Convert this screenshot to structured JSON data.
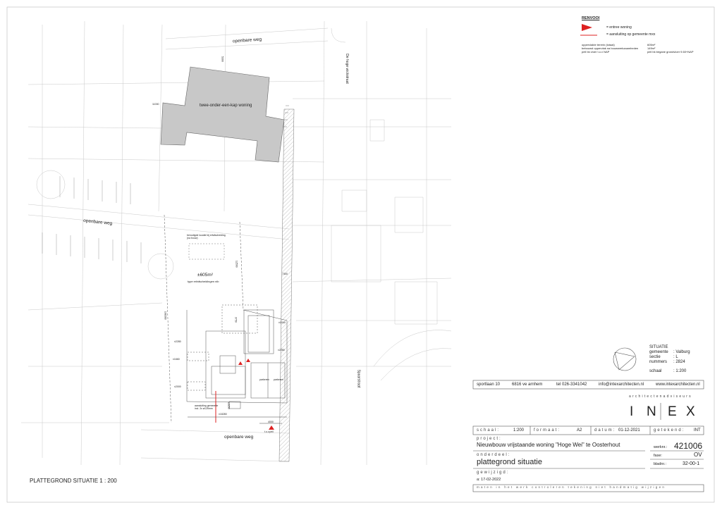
{
  "legend": {
    "title": "RENVOOI",
    "entrance": "= entree woning",
    "connection": "= aansluiting op gemeente mxx",
    "area_labels": [
      "oppervlakte terrein (totaal)",
      "bebouwd oppervlak na bouwwerkzaamheden",
      "peil bk vloer t.o.v NAP"
    ],
    "area_values": [
      "605m²",
      "149m²",
      "peil bk begane grondvloer 9.60+NAP"
    ]
  },
  "map": {
    "road_top": "openbare weg",
    "road_left": "openbare weg",
    "road_bottom": "openbare weg",
    "street_right_top": "De hoge wickstraat",
    "street_right_bottom": "Spaarstraat",
    "neighbor_house": "twee-onder-een-kap woning",
    "plot_area": "±605m²",
    "plot_note": "type erfafscheidingen nib",
    "box_note": "benodigde locatie bij erfafscheiding (na bouw)",
    "parking_labels": [
      "parkeren",
      "parkeren"
    ],
    "connection_note": "aansluiting gemeente incl. 2x ø125mm",
    "dims": [
      "5300",
      "11000",
      "12590",
      "7300",
      "±1000",
      "±2280",
      "±2280",
      "±1660",
      "±2000",
      "±18280",
      "±3250",
      "4000",
      "3750",
      "108300"
    ],
    "level_mark": "t.o.v.peil"
  },
  "drawing_title": "PLATTEGROND SITUATIE  1 : 200",
  "situatie": {
    "title": "SITUATIE",
    "rows": [
      {
        "k": "gemeente",
        "v": ": Valburg"
      },
      {
        "k": "sectie",
        "v": ": L"
      },
      {
        "k": "nummers",
        "v": ": 2824"
      },
      {
        "k": "schaal",
        "v": ": 1:200"
      }
    ]
  },
  "contact": {
    "address": "sportlaan 10",
    "city": "6816 ve arnhem",
    "tel": "tel 026-3341042",
    "email": "info@intexarchitecten.nl",
    "web": "www.intexarchitecten.nl"
  },
  "brand": {
    "tagline": "architectenadviseurs",
    "letters": [
      "I",
      "N",
      "E",
      "X"
    ]
  },
  "titleblock": {
    "schaal_label": "schaal:",
    "schaal_value": "1:200",
    "formaat_label": "formaat:",
    "formaat_value": "A2",
    "datum_label": "datum:",
    "datum_value": "01-12-2021",
    "getekend_label": "getekend:",
    "getekend_value": "INT",
    "project_label": "project:",
    "project_value": "Nieuwbouw vrijstaande woning \"Hoge Wei\" te Oosterhout",
    "werknr_label": "werknr.:",
    "werknr_value": "421006",
    "fase_label": "fase:",
    "fase_value": "OV",
    "onderdeel_label": "onderdeel:",
    "onderdeel_value": "plattegrond situatie",
    "bladnr_label": "bladnr.:",
    "bladnr_value": "32-00-1",
    "gewijzigd_label": "gewijzigd:",
    "gewijzigd_value": "a:  17-02-2022",
    "footer": "maten in het werk controleren   tekening niet handmatig wijzigen"
  }
}
